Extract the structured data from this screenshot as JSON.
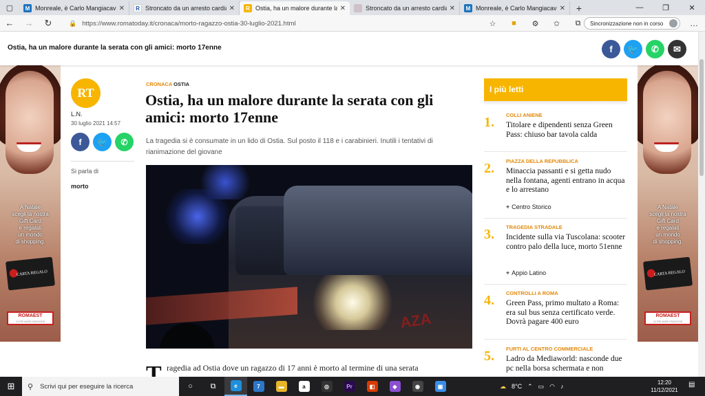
{
  "browser": {
    "tabs": [
      {
        "title": "Monreale, è Carlo Mangiacavallo",
        "fav": "M",
        "color": "#1e73be",
        "active": false
      },
      {
        "title": "Stroncato da un arresto cardiaco",
        "fav": "R",
        "color": "#ffffff",
        "fav_text": "#1e4fa0",
        "active": false
      },
      {
        "title": "Ostia, ha un malore durante la se",
        "fav": "RT",
        "color": "#f7b500",
        "active": true
      },
      {
        "title": "Stroncato da un arresto cardiaco",
        "fav": "",
        "color": "#c8c8c8",
        "active": false
      },
      {
        "title": "Monreale, è Carlo Mangiacavallo",
        "fav": "M",
        "color": "#1e73be",
        "active": false
      }
    ],
    "url": "https://www.romatoday.it/cronaca/morto-ragazzo-ostia-30-luglio-2021.html",
    "sync_label": "Sincronizzazione non in corso"
  },
  "sticky": {
    "title": "Ostia, ha un malore durante la serata con gli amici: morto 17enne"
  },
  "author": {
    "avatar_text": "RT",
    "name": "L.N.",
    "date": "30 luglio 2021 14:57",
    "sparla_label": "Si parla di",
    "tag": "morto"
  },
  "article": {
    "category": "CRONACA",
    "subcategory": "OSTIA",
    "headline": "Ostia, ha un malore durante la serata con gli amici: morto 17enne",
    "summary": "La tragedia si è consumate in un lido di Ostia. Sul posto il 118 e i carabinieri. Inutili i tentativi di rianimazione del giovane",
    "dropcap": "T",
    "body_start": "ragedia ad Ostia dove un ragazzo di 17 anni è morto al termine di una serata",
    "photo_text": "AZA"
  },
  "sidebar": {
    "header": "I più letti",
    "items": [
      {
        "num": "1.",
        "category": "COLLI ANIENE",
        "title": "Titolare e dipendenti senza Green Pass: chiuso bar tavola calda",
        "location": ""
      },
      {
        "num": "2.",
        "category": "PIAZZA DELLA REPUBBLICA",
        "title": "Minaccia passanti e si getta nudo nella fontana, agenti entrano in acqua e lo arrestano",
        "location": "Centro Storico"
      },
      {
        "num": "3.",
        "category": "TRAGEDIA STRADALE",
        "title": "Incidente sulla via Tuscolana: scooter contro palo della luce, morto 51enne",
        "location": "Appio Latino"
      },
      {
        "num": "4.",
        "category": "CONTROLLI A ROMA",
        "title": "Green Pass, primo multato a Roma: era sul bus senza certificato verde. Dovrà pagare 400 euro",
        "location": ""
      },
      {
        "num": "5.",
        "category": "FURTI AL CENTRO COMMERCIALE",
        "title": "Ladro da Mediaworld: nasconde due pc nella borsa schermata e non",
        "location": ""
      }
    ]
  },
  "ad": {
    "text": [
      "A Natale",
      "scegli la nostra",
      "Gift Card",
      "e regalati",
      "un mondo",
      "di shopping."
    ],
    "card_text": "CARTA REGALO",
    "logo": "ROMAEST",
    "logo_sub": "OLTRE MARE EMOZIONE"
  },
  "taskbar": {
    "search_placeholder": "Scrivi qui per eseguire la ricerca",
    "temperature": "8°C",
    "time": "12:20",
    "date": "11/12/2021",
    "badge": "7"
  },
  "colors": {
    "facebook": "#3b5998",
    "twitter": "#1da1f2",
    "whatsapp": "#25d366",
    "email": "#333333",
    "accent": "#f7b500",
    "category": "#e2890b"
  }
}
